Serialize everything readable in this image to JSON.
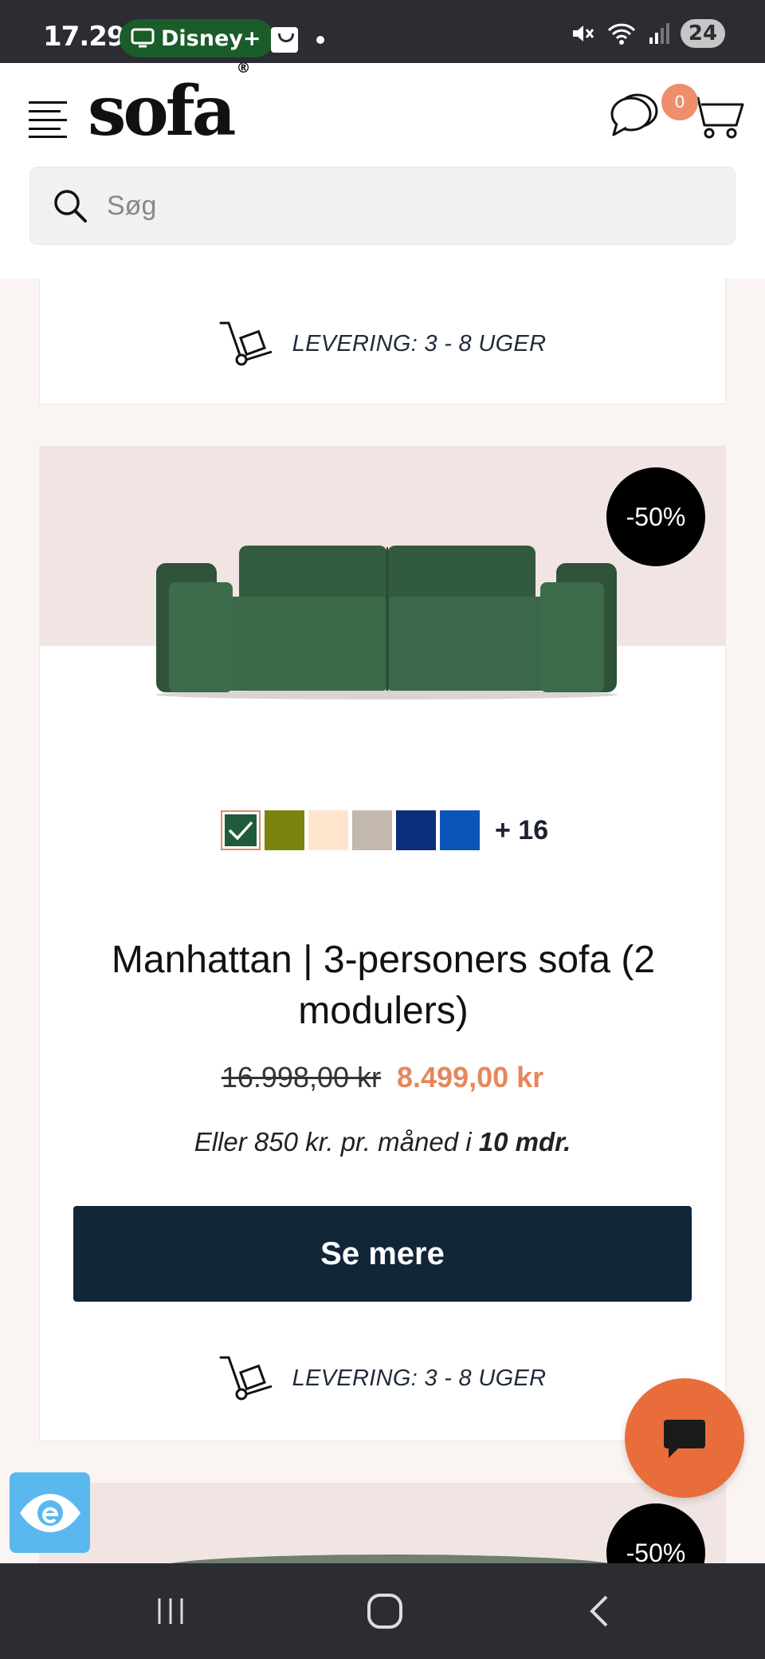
{
  "status_bar": {
    "time": "17.29",
    "app_pill_label": "Disney+",
    "battery": "24"
  },
  "header": {
    "logo": "sofa",
    "logo_mark": "®",
    "cart_count": "0",
    "search": {
      "placeholder": "Søg"
    }
  },
  "previous_card": {
    "delivery": "LEVERING: 3 - 8 UGER"
  },
  "product": {
    "discount": "-50%",
    "swatches": [
      {
        "color": "#1f5a3a",
        "selected": true
      },
      {
        "color": "#7a8210",
        "selected": false
      },
      {
        "color": "#fde4cc",
        "selected": false
      },
      {
        "color": "#c2b8ae",
        "selected": false
      },
      {
        "color": "#0c2e7a",
        "selected": false
      },
      {
        "color": "#0a55b8",
        "selected": false
      }
    ],
    "more_colors": "+ 16",
    "title": "Manhattan | 3-personers sofa (2 modulers)",
    "old_price": "16.998,00 kr",
    "new_price": "8.499,00 kr",
    "installment_prefix": "Eller 850 kr. pr. måned i ",
    "installment_bold": "10 mdr.",
    "button_label": "Se mere",
    "delivery": "LEVERING: 3 - 8 UGER"
  },
  "next_card": {
    "discount": "-50%"
  },
  "icons": {
    "menu": "menu-icon",
    "chat": "chat-icon",
    "cart": "cart-icon",
    "search": "search-icon",
    "delivery": "hand-truck-icon",
    "chat_fab": "chat-bubble-icon",
    "accessibility": "eye-icon"
  },
  "colors": {
    "accent": "#e5875c",
    "button": "#12263a",
    "chat_fab": "#e96d3b",
    "accessibility": "#5ab8ee"
  }
}
